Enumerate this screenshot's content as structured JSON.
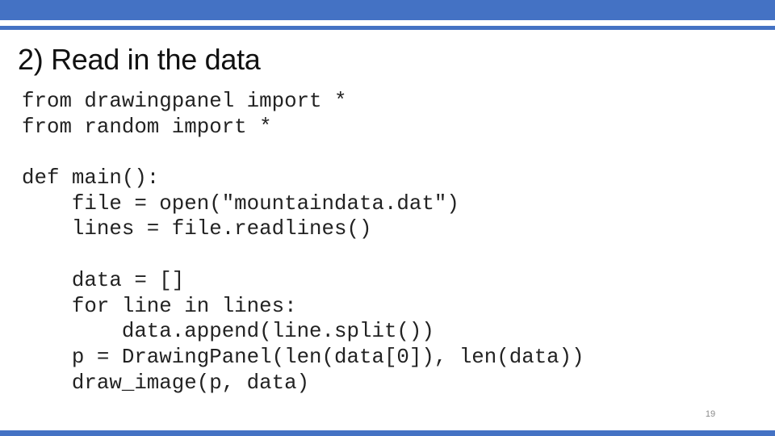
{
  "slide": {
    "title": "2) Read in the data",
    "page_number": "19",
    "accent_color": "#4472C4"
  },
  "code": {
    "language": "python",
    "lines": [
      "from drawingpanel import *",
      "from random import *",
      "",
      "def main():",
      "    file = open(\"mountaindata.dat\")",
      "    lines = file.readlines()",
      "",
      "    data = []",
      "    for line in lines:",
      "        data.append(line.split())",
      "    p = DrawingPanel(len(data[0]), len(data))",
      "    draw_image(p, data)"
    ]
  }
}
